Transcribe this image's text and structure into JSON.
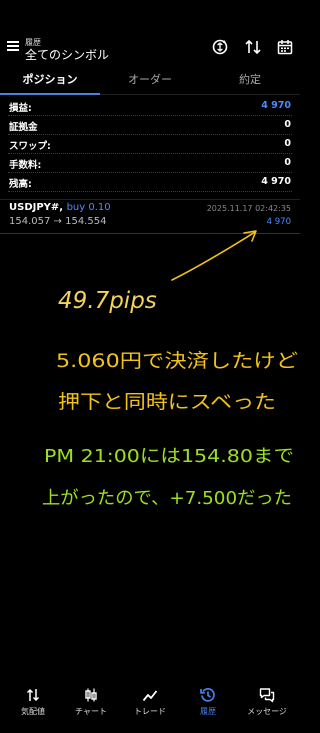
{
  "header": {
    "subtitle": "履歴",
    "title": "全てのシンボル",
    "icons": [
      "sync-currency-icon",
      "sort-icon",
      "calendar-icon"
    ]
  },
  "tabs": [
    {
      "label": "ポジション",
      "active": true
    },
    {
      "label": "オーダー",
      "active": false
    },
    {
      "label": "約定",
      "active": false
    }
  ],
  "summary": [
    {
      "label": "損益:",
      "value": "4 970",
      "color": "#4a8cff"
    },
    {
      "label": "証拠金",
      "value": "0",
      "color": "#ffffff"
    },
    {
      "label": "スワップ:",
      "value": "0",
      "color": "#ffffff"
    },
    {
      "label": "手数料:",
      "value": "0",
      "color": "#ffffff"
    },
    {
      "label": "残高:",
      "value": "4 970",
      "color": "#ffffff"
    }
  ],
  "position": {
    "symbol": "USDJPY#,",
    "side": "buy 0.10",
    "prices": "154.057 → 154.554",
    "time": "2025.11.17 02:42:35",
    "profit": "4 970"
  },
  "annotations": {
    "color": "#f2c21a",
    "pips_color": "#f5d25a",
    "green_color": "#9be01f",
    "pips": "49.7pips",
    "line1": "5.060円で決済したけど",
    "line2": "押下と同時にスベった",
    "line3": "PM 21:00には154.80まで",
    "line4": "上がったので、+7.500だった"
  },
  "nav": [
    {
      "label": "気配値",
      "icon": "quotes-icon",
      "active": false
    },
    {
      "label": "チャート",
      "icon": "chart-icon",
      "active": false
    },
    {
      "label": "トレード",
      "icon": "trade-icon",
      "active": false
    },
    {
      "label": "履歴",
      "icon": "history-icon",
      "active": true
    },
    {
      "label": "メッセージ",
      "icon": "messages-icon",
      "active": false
    }
  ]
}
